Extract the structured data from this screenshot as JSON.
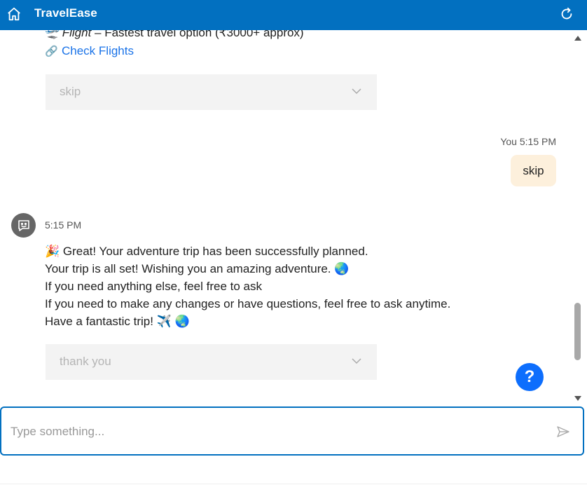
{
  "header": {
    "title": "TravelEase",
    "bg_color": "#0270c0",
    "home_icon": "home-icon",
    "refresh_icon": "refresh-icon"
  },
  "chat": {
    "flight_option": {
      "emoji": "🛫",
      "mode": "Flight",
      "description": " – Fastest travel option (₹3000+ approx)"
    },
    "flight_link": {
      "emoji": "🔗",
      "label": "Check Flights"
    },
    "select_1": {
      "value": "skip"
    },
    "user_message": {
      "meta": "You 5:15 PM",
      "text": "skip",
      "bubble_color": "#fdf0dc"
    },
    "bot_message": {
      "time": "5:15 PM",
      "lines": [
        "🎉 Great! Your adventure trip has been successfully planned.",
        "Your trip is all set! Wishing you an amazing adventure. 🌏",
        "If you need anything else, feel free to ask",
        "If you need to make any changes or have questions, feel free to ask anytime.",
        "Have a fantastic trip! ✈️ 🌏"
      ]
    },
    "select_2": {
      "value": "thank you"
    }
  },
  "help_button": {
    "label": "?",
    "color": "#0d6efd"
  },
  "composer": {
    "placeholder": "Type something...",
    "send_icon": "send-icon"
  }
}
